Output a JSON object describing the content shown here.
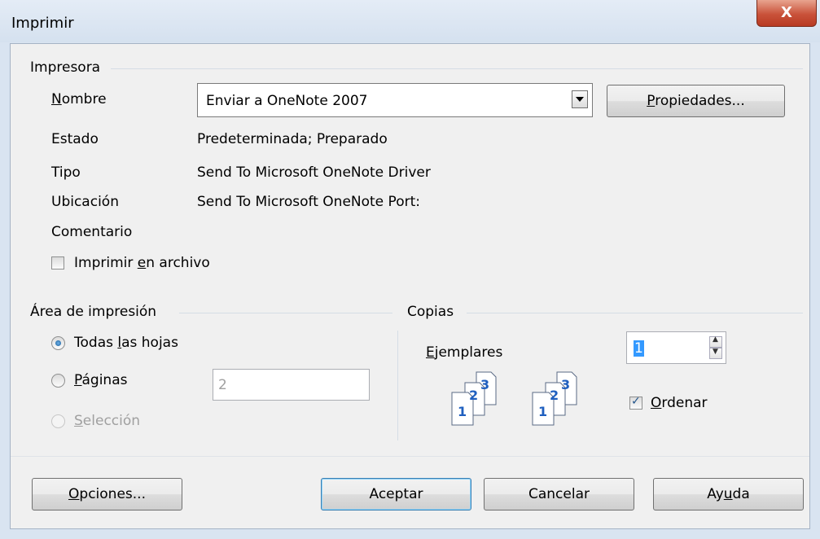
{
  "window": {
    "title": "Imprimir",
    "close_glyph": "X"
  },
  "printer": {
    "section_label": "Impresora",
    "name_label_prefix": "",
    "name_label_underline": "N",
    "name_label_rest": "ombre",
    "selected_printer": "Enviar a OneNote 2007",
    "properties_underline": "P",
    "properties_rest": "ropiedades...",
    "status_label": "Estado",
    "status_value": "Predeterminada; Preparado",
    "type_label": "Tipo",
    "type_value": "Send To Microsoft OneNote Driver",
    "location_label": "Ubicación",
    "location_value": "Send To Microsoft OneNote Port:",
    "comment_label": "Comentario",
    "print_to_file_prefix": "Imprimir ",
    "print_to_file_underline": "e",
    "print_to_file_rest": "n archivo",
    "print_to_file_checked": false
  },
  "print_area": {
    "section_label": "Área de impresión",
    "all_sheets_prefix": "Todas ",
    "all_sheets_underline": "l",
    "all_sheets_rest": "as hojas",
    "pages_underline": "P",
    "pages_rest": "áginas",
    "pages_value": "2",
    "selection_underline": "S",
    "selection_rest": "elección",
    "selected_option": "all_sheets"
  },
  "copies": {
    "section_label": "Copias",
    "copies_label_underline": "E",
    "copies_label_rest": "jemplares",
    "copies_value": "1",
    "collate_underline": "O",
    "collate_rest": "rdenar",
    "collate_checked": true,
    "page_numbers": [
      "1",
      "2",
      "3"
    ]
  },
  "buttons": {
    "options_underline": "O",
    "options_rest": "pciones...",
    "ok": "Aceptar",
    "cancel": "Cancelar",
    "help_prefix": "Ay",
    "help_underline": "u",
    "help_rest": "da"
  },
  "colors": {
    "accent": "#1a5e9a",
    "close": "#c9523a",
    "doc_number": "#1f5fbf"
  }
}
